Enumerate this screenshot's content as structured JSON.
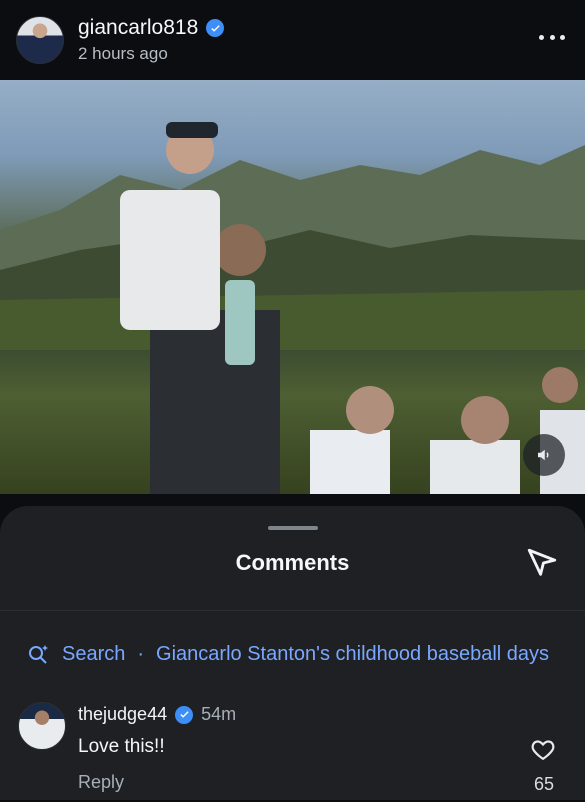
{
  "post": {
    "username": "giancarlo818",
    "time": "2 hours ago",
    "volume_icon": "volume-icon"
  },
  "comments": {
    "title": "Comments",
    "search_prefix": "Search",
    "search_text": "Giancarlo Stanton's childhood baseball days",
    "items": [
      {
        "username": "thejudge44",
        "time": "54m",
        "text": "Love this!!",
        "reply_label": "Reply",
        "likes": "65"
      }
    ]
  },
  "colors": {
    "background": "#0b0d10",
    "sheet": "#1e2024",
    "accent_link": "#7aa7ff",
    "verified": "#3d8ef7"
  }
}
